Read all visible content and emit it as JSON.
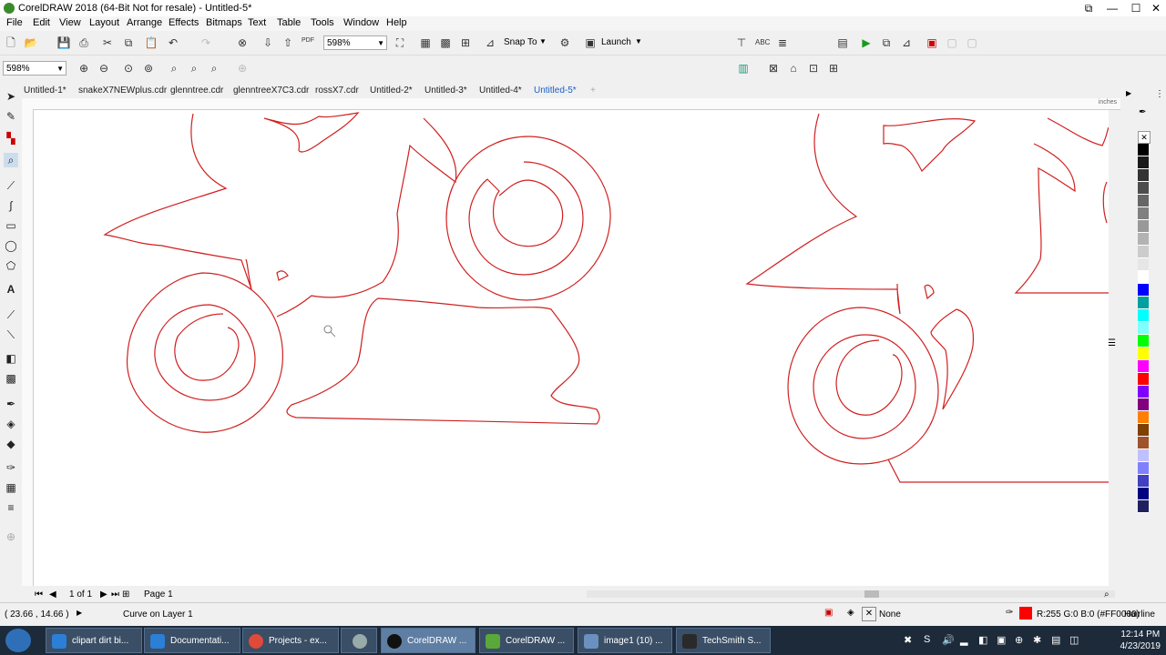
{
  "window": {
    "title": "CorelDRAW 2018 (64-Bit Not for resale) - Untitled-5*"
  },
  "menu": [
    "File",
    "Edit",
    "View",
    "Layout",
    "Arrange",
    "Effects",
    "Bitmaps",
    "Text",
    "Table",
    "Tools",
    "Window",
    "Help"
  ],
  "toolbar": {
    "zoom_value": "598%",
    "snap_label": "Snap To",
    "launch_label": "Launch",
    "pdf_label": "PDF"
  },
  "propbar": {
    "zoom_value": "598%"
  },
  "tabs": [
    {
      "label": "Untitled-1*"
    },
    {
      "label": "snakeX7NEWplus.cdr"
    },
    {
      "label": "glenntree.cdr"
    },
    {
      "label": "glenntreeX7C3.cdr"
    },
    {
      "label": "rossX7.cdr"
    },
    {
      "label": "Untitled-2*"
    },
    {
      "label": "Untitled-3*"
    },
    {
      "label": "Untitled-4*"
    },
    {
      "label": "Untitled-5*"
    }
  ],
  "ruler": {
    "unit": "inches"
  },
  "pagebar": {
    "page_of": "1 of 1",
    "page_tab": "Page 1"
  },
  "status": {
    "coords": "( 23.66 , 14.66 )",
    "object_info": "Curve on Layer 1",
    "fill_label": "None",
    "outline_color": "R:255 G:0 B:0 (#FF0000)",
    "outline_width": "Hairline",
    "outline_hex": "#FF0000"
  },
  "palette_colors": [
    "#000000",
    "#1a1a1a",
    "#333333",
    "#4d4d4d",
    "#666666",
    "#808080",
    "#999999",
    "#b3b3b3",
    "#cccccc",
    "#e6e6e6",
    "#ffffff",
    "#0000ff",
    "#00a0a0",
    "#00ffff",
    "#80ffff",
    "#00ff00",
    "#ffff00",
    "#ff00ff",
    "#ff0000",
    "#8000ff",
    "#800080",
    "#ff8000",
    "#804000",
    "#a0522d",
    "#c0c0ff",
    "#8080ff",
    "#4040c0",
    "#000080",
    "#202060"
  ],
  "taskbar": {
    "items": [
      {
        "label": "clipart dirt bi..."
      },
      {
        "label": "Documentati..."
      },
      {
        "label": "Projects - ex..."
      },
      {
        "label": ""
      },
      {
        "label": "CorelDRAW ..."
      },
      {
        "label": "CorelDRAW ..."
      },
      {
        "label": "image1 (10) ..."
      },
      {
        "label": "TechSmith S..."
      }
    ],
    "time": "12:14 PM",
    "date": "4/23/2019"
  }
}
